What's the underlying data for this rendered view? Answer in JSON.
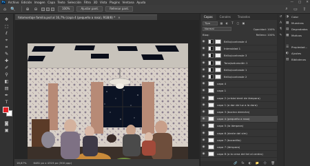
{
  "app": {
    "logo": "Ps"
  },
  "menu": [
    "Archivo",
    "Edición",
    "Imagen",
    "Capa",
    "Texto",
    "Selección",
    "Filtro",
    "3D",
    "Vista",
    "Plugins",
    "Ventana",
    "Ayuda"
  ],
  "window_controls": {
    "minimize": "—",
    "maximize": "□",
    "close": "✕"
  },
  "options_bar": {
    "zoom_in": "⊕",
    "zoom_out": "⊖",
    "resize_label": "",
    "hundred_btn": "100%",
    "fit_btn": "Ajustar pant.",
    "fill_btn": "Rellenar pant."
  },
  "document_tab": {
    "title": "fotomontaje familia.psd al 16,7% (capa 4 (pequeño a rosa), RGB/8) *",
    "close": "✕"
  },
  "status_bar": {
    "zoom": "16,67%",
    "size": "6481 px x 4319 px (300 ppp)"
  },
  "layers_panel": {
    "tabs": [
      "Capas",
      "Canales",
      "Trazados"
    ],
    "active_tab": "Capas",
    "filter_label": "Tipo",
    "blend_mode": "Normal",
    "opacity_label": "Opacidad: 100%",
    "fill_label": "Relleno: 100%",
    "lock_label": "Bloq:",
    "layers": [
      {
        "name": "Brillo/contraste 4",
        "type": "adjustment",
        "mask": "white"
      },
      {
        "name": "Intensidad 1",
        "type": "adjustment",
        "mask": "white"
      },
      {
        "name": "Brillo/contraste 3",
        "type": "adjustment",
        "mask": "white"
      },
      {
        "name": "Tono/saturación 1",
        "type": "adjustment",
        "mask": "white"
      },
      {
        "name": "Brillo/contraste 1",
        "type": "adjustment",
        "mask": "white"
      },
      {
        "name": "Brillo/contraste 2",
        "type": "adjustment",
        "mask": "white"
      },
      {
        "name": "capa 4",
        "type": "pixel"
      },
      {
        "name": "capa 1",
        "type": "pixel"
      },
      {
        "name": "capa 2 (cristal dent de lámpara)",
        "type": "pixel"
      },
      {
        "name": "capa 1 (a dar de luz a la dora)",
        "type": "pixel"
      },
      {
        "name": "capa 3 (bocina derecha)",
        "type": "pixel"
      },
      {
        "name": "capa 4 (pequeño a rosa)",
        "type": "pixel",
        "selected": true
      },
      {
        "name": "capa 5 (la lámpara)",
        "type": "pixel"
      },
      {
        "name": "capa 6 (dente del sim)",
        "type": "pixel"
      },
      {
        "name": "capa 7 (bocadillo)",
        "type": "pixel"
      },
      {
        "name": "capa 7 (lámpara)",
        "type": "pixel"
      },
      {
        "name": "capa 8 (a la cena del tel al centro)",
        "type": "pixel"
      }
    ],
    "footer_icons": [
      "🔗",
      "fx",
      "◐",
      "📁",
      "➕",
      "🗑"
    ]
  },
  "dock": {
    "groups": [
      [
        "Color",
        "Muestras",
        "Degradados",
        "Motivos"
      ],
      [
        "Propiedad...",
        "Ajustes",
        "Bibliotecas"
      ]
    ]
  },
  "colors": {
    "foreground": "#e31e24",
    "background": "#ffffff"
  }
}
